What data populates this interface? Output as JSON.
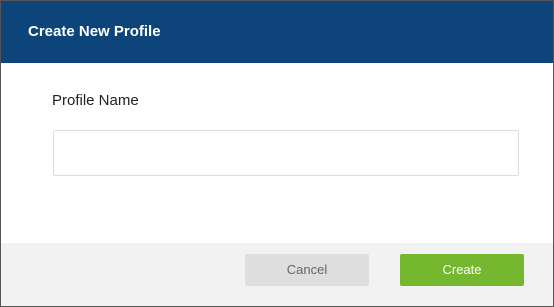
{
  "dialog": {
    "title": "Create New Profile",
    "field_label": "Profile Name",
    "field_value": "",
    "cancel_label": "Cancel",
    "create_label": "Create"
  },
  "colors": {
    "header_bg": "#0d4479",
    "create_button": "#75b72f",
    "cancel_button": "#dedede",
    "footer_bg": "#f2f2f2"
  }
}
